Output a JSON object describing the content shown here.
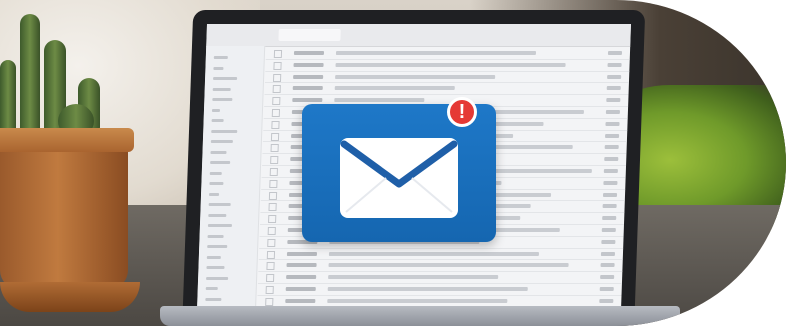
{
  "scene": {
    "description_tag": "laptop-email-notification-photo",
    "colors": {
      "envelope_card": "#1e78c8",
      "badge": "#e53935",
      "envelope": "#ffffff",
      "envelope_flap_line": "#1f5fa8"
    }
  },
  "notification": {
    "badge_glyph": "!"
  },
  "icons": [
    "envelope-icon",
    "alert-badge-icon",
    "cactus-plant",
    "laptop"
  ]
}
